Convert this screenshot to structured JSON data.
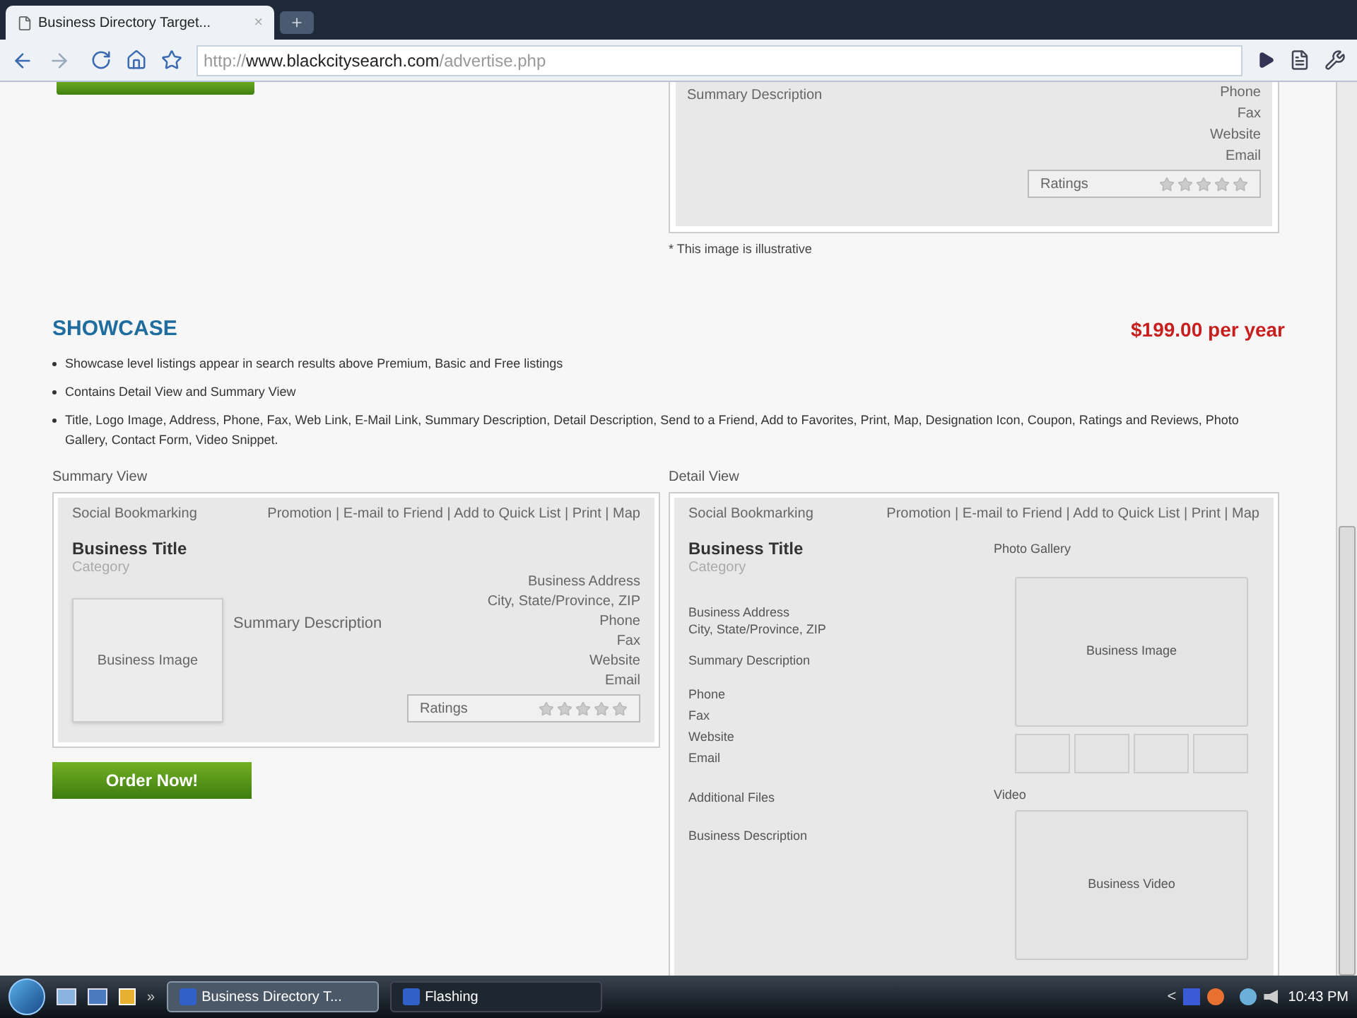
{
  "browser": {
    "tab": {
      "title": "Business Directory Target...",
      "close": "×"
    },
    "url": {
      "scheme": "http://",
      "host": "www.blackcitysearch.com",
      "path": "/advertise.php"
    }
  },
  "page": {
    "top_card": {
      "description": "Summary Description",
      "contacts": [
        "Phone",
        "Fax",
        "Website",
        "Email"
      ],
      "ratings": {
        "label": "Ratings",
        "stars": 0
      }
    },
    "note": "* This image is illustrative",
    "showcase": {
      "title": "SHOWCASE",
      "price": "$199.00 per year",
      "bullets": [
        "Showcase level listings appear in search results above Premium, Basic and Free listings",
        "Contains Detail View and Summary View",
        "Title, Logo Image, Address, Phone, Fax, Web Link, E-Mail Link, Summary Description, Detail Description, Send to a Friend, Add to Favorites, Print, Map, Designation Icon, Coupon, Ratings and Reviews, Photo Gallery, Contact Form, Video Snippet."
      ],
      "summary_view": {
        "label": "Summary View",
        "social": "Social Bookmarking",
        "links": "Promotion | E-mail to Friend | Add to Quick List | Print | Map",
        "title": "Business Title",
        "category": "Category",
        "image": "Business Image",
        "description": "Summary Description",
        "address": [
          "Business Address",
          "City, State/Province, ZIP"
        ],
        "contacts": [
          "Phone",
          "Fax",
          "Website",
          "Email"
        ],
        "ratings": {
          "label": "Ratings",
          "stars": 0
        }
      },
      "order_button": "Order Now!",
      "detail_view": {
        "label": "Detail View",
        "social": "Social Bookmarking",
        "links": "Promotion | E-mail to Friend | Add to Quick List | Print | Map",
        "title": "Business Title",
        "category": "Category",
        "address": [
          "Business Address",
          "City, State/Province, ZIP"
        ],
        "description": "Summary Description",
        "contacts": [
          "Phone",
          "Fax",
          "Website",
          "Email"
        ],
        "files": "Additional Files",
        "business_description": "Business Description",
        "gallery_label": "Photo Gallery",
        "image": "Business Image",
        "video_label": "Video",
        "video": "Business Video"
      }
    }
  },
  "taskbar": {
    "overflow": "»",
    "tasks": [
      {
        "label": "Business Directory T...",
        "selected": true
      },
      {
        "label": "Flashing",
        "selected": false
      }
    ],
    "tray_caret": "<",
    "clock": "10:43 PM"
  }
}
